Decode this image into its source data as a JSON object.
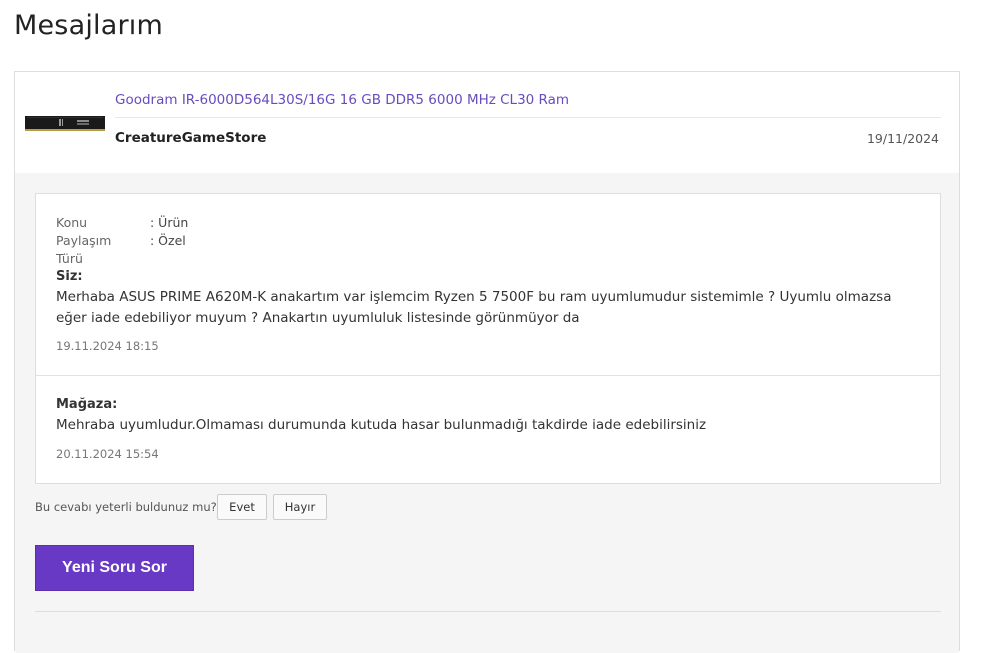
{
  "page": {
    "title": "Mesajlarım"
  },
  "product": {
    "name": "Goodram IR-6000D564L30S/16G 16 GB DDR5 6000 MHz CL30 Ram",
    "store": "CreatureGameStore",
    "date": "19/11/2024",
    "image_icon": "ram-module-image"
  },
  "thread": {
    "meta": [
      {
        "key": "Konu",
        "value": ": Ürün"
      },
      {
        "key": "Paylaşım",
        "value": ": Özel"
      },
      {
        "key": "Türü",
        "value": ""
      }
    ],
    "messages": [
      {
        "sender": "Siz:",
        "text": "Merhaba ASUS PRIME A620M-K anakartım var işlemcim Ryzen 5 7500F bu ram uyumlumudur sistemimle ? Uyumlu olmazsa eğer iade edebiliyor muyum ? Anakartın uyumluluk listesinde görünmüyor da",
        "timestamp": "19.11.2024 18:15"
      },
      {
        "sender": "Mağaza:",
        "text": "Mehraba uyumludur.Olmaması durumunda kutuda hasar bulunmadığı takdirde iade edebilirsiniz",
        "timestamp": "20.11.2024 15:54"
      }
    ]
  },
  "feedback": {
    "question": "Bu cevabı yeterli buldunuz mu?",
    "yes_label": "Evet",
    "no_label": "Hayır"
  },
  "actions": {
    "new_question_label": "Yeni Soru Sor"
  },
  "colors": {
    "accent": "#6739c4",
    "link": "#6a4bbf",
    "panel_bg": "#f5f5f5"
  }
}
